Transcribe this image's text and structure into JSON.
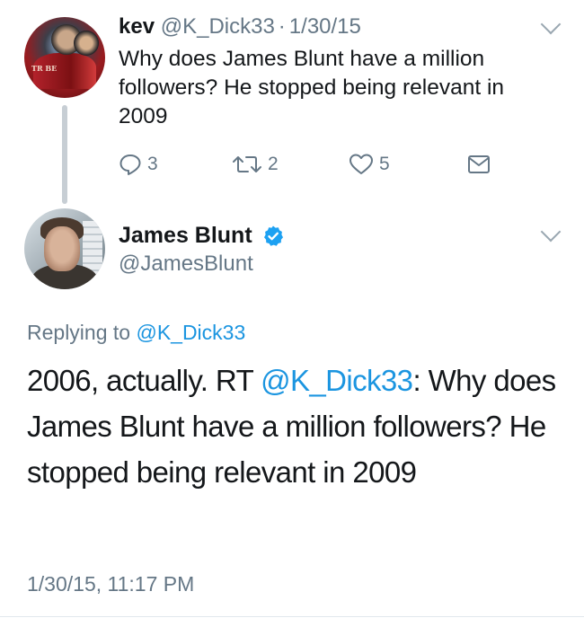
{
  "parent_tweet": {
    "name": "kev",
    "handle": "@K_Dick33",
    "separator": "·",
    "date": "1/30/15",
    "text": "Why does James Blunt have a million followers? He stopped being relevant in 2009",
    "avatar_text": "TR BE",
    "actions": {
      "reply_count": "3",
      "retweet_count": "2",
      "like_count": "5"
    },
    "icons": [
      "reply-icon",
      "retweet-icon",
      "like-icon",
      "direct-message-icon",
      "chevron-down-icon"
    ]
  },
  "main_tweet": {
    "name": "James Blunt",
    "handle": "@JamesBlunt",
    "verified": true,
    "replying_prefix": "Replying to ",
    "replying_to": "@K_Dick33",
    "text_before_mention": "2006, actually. RT ",
    "mention": "@K_Dick33",
    "text_after_mention": ": Why does James Blunt have a million followers? He stopped being relevant in 2009",
    "timestamp": "1/30/15, 11:17 PM",
    "icons": [
      "verified-badge-icon",
      "chevron-down-icon"
    ]
  },
  "colors": {
    "text": "#14171a",
    "muted": "#657786",
    "link": "#1b95e0",
    "verified": "#1da1f2",
    "thread_line": "#c7ced4"
  }
}
